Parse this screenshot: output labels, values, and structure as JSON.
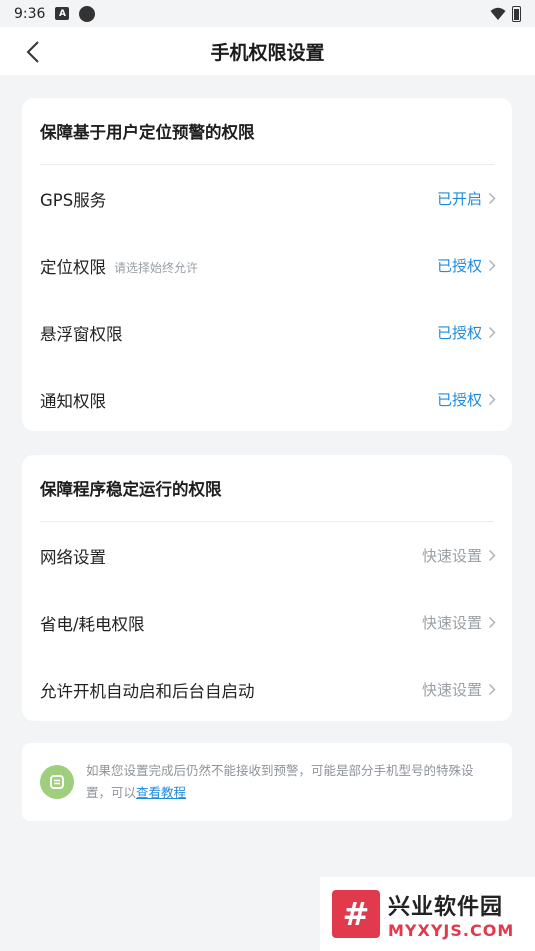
{
  "status_bar": {
    "time": "9:36",
    "notification_icon": "A"
  },
  "header": {
    "title": "手机权限设置",
    "back_icon": "chevron-left"
  },
  "section1": {
    "title": "保障基于用户定位预警的权限",
    "items": [
      {
        "label": "GPS服务",
        "hint": "",
        "status": "已开启"
      },
      {
        "label": "定位权限",
        "hint": "请选择始终允许",
        "status": "已授权"
      },
      {
        "label": "悬浮窗权限",
        "hint": "",
        "status": "已授权"
      },
      {
        "label": "通知权限",
        "hint": "",
        "status": "已授权"
      }
    ]
  },
  "section2": {
    "title": "保障程序稳定运行的权限",
    "items": [
      {
        "label": "网络设置",
        "status": "快速设置"
      },
      {
        "label": "省电/耗电权限",
        "status": "快速设置"
      },
      {
        "label": "允许开机自动启和后台自启动",
        "status": "快速设置"
      }
    ]
  },
  "note": {
    "text": "如果您设置完成后仍然不能接收到预警，可能是部分手机型号的特殊设置，可以",
    "link": "查看教程"
  },
  "watermark": {
    "logo": "#",
    "title": "兴业软件园",
    "subtitle": "MYXYJS.COM"
  },
  "colors": {
    "accent": "#1f8bdc",
    "muted": "#9aa0a6",
    "background": "#f3f4f6",
    "note_icon": "#9fce7c"
  }
}
